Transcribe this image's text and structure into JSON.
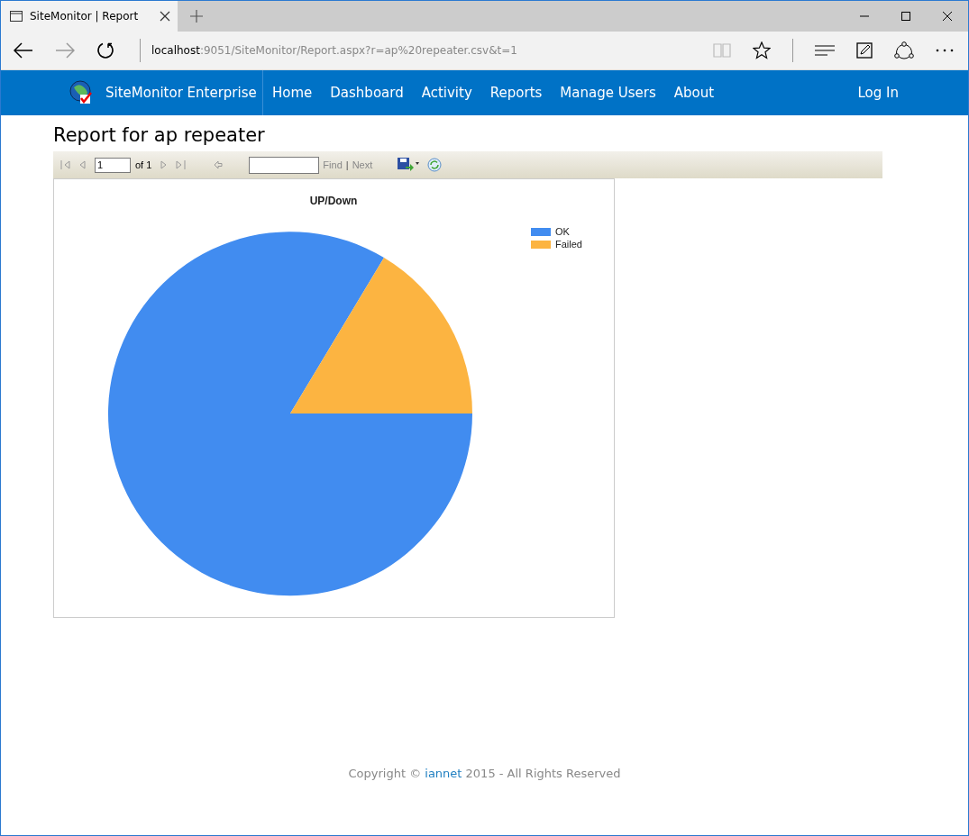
{
  "browser": {
    "tab_title": "SiteMonitor | Report",
    "address_host": "localhost",
    "address_rest": ":9051/SiteMonitor/Report.aspx?r=ap%20repeater.csv&t=1"
  },
  "navbar": {
    "brand": "SiteMonitor Enterprise",
    "items": [
      {
        "label": "Home"
      },
      {
        "label": "Dashboard"
      },
      {
        "label": "Activity"
      },
      {
        "label": "Reports"
      },
      {
        "label": "Manage Users"
      },
      {
        "label": "About"
      }
    ],
    "login": "Log In"
  },
  "page_title": "Report for ap repeater",
  "report_toolbar": {
    "page_value": "1",
    "page_total": "of 1",
    "find": "Find",
    "separator": "|",
    "next": "Next"
  },
  "chart": {
    "title": "UP/Down",
    "legend": [
      {
        "label": "OK",
        "color": "#418cf0"
      },
      {
        "label": "Failed",
        "color": "#fcb441"
      }
    ]
  },
  "footer": {
    "before": "Copyright © ",
    "link": "iannet",
    "after": " 2015 - All Rights Reserved"
  }
}
